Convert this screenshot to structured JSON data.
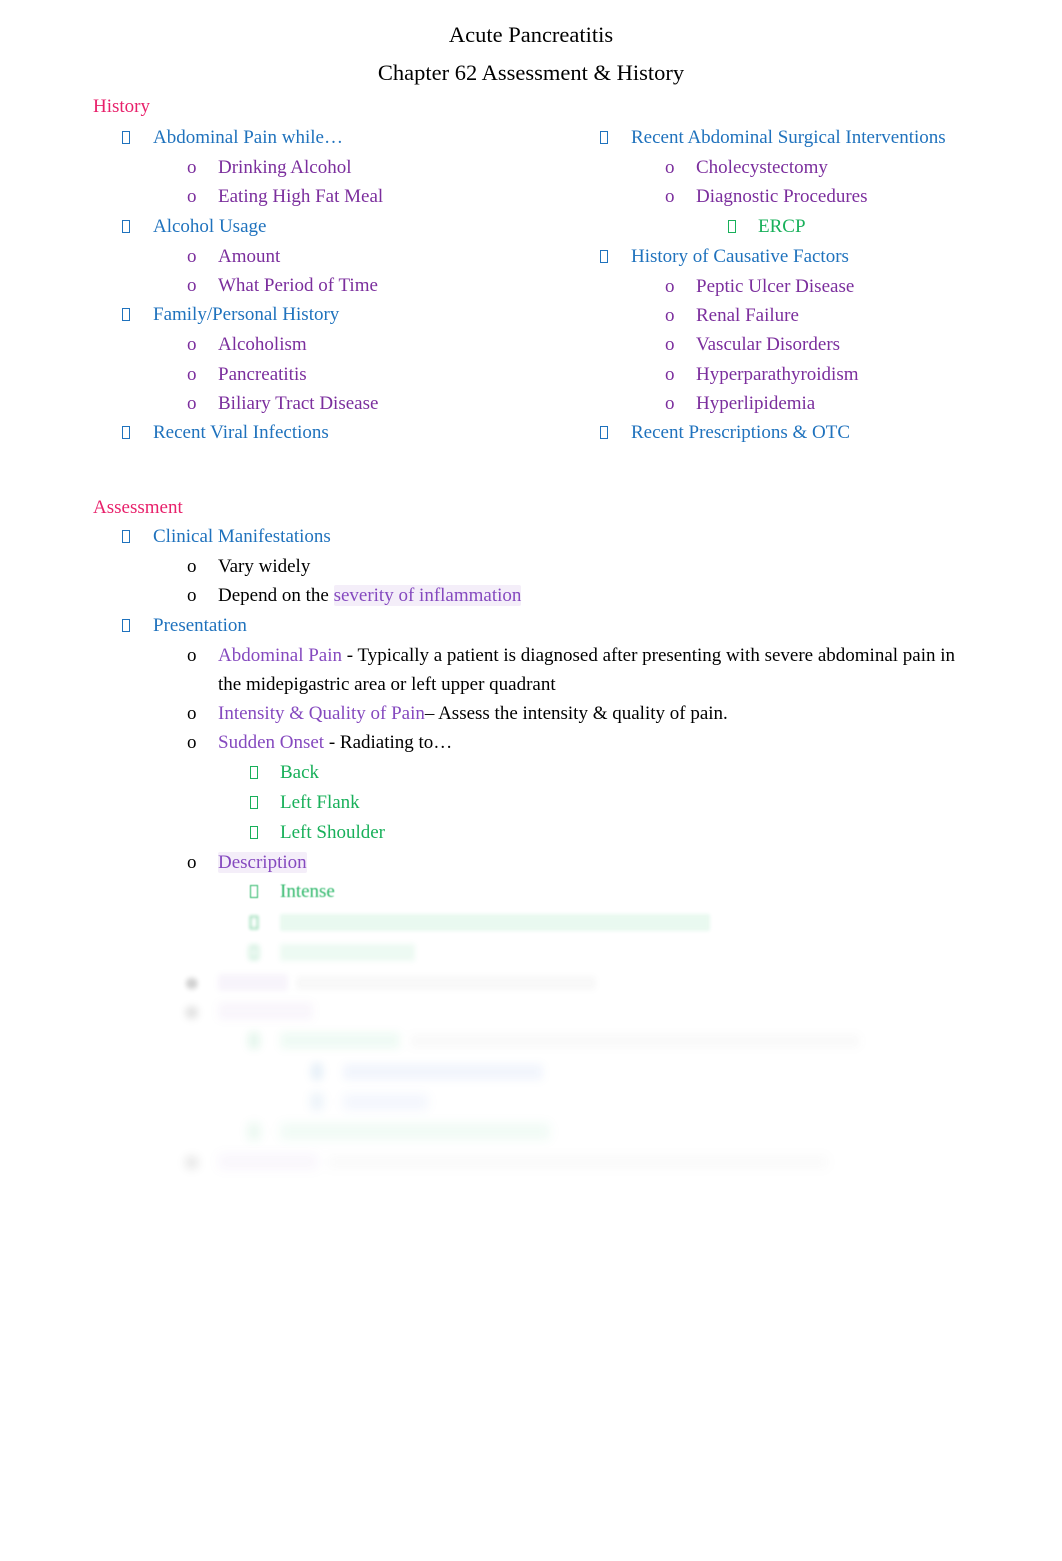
{
  "document": {
    "title": "Acute Pancreatitis",
    "subtitle": "Chapter 62 Assessment & History"
  },
  "colors": {
    "heading_pink": "#E8216B",
    "level1_blue": "#1F72BD",
    "level2_purple": "#7B2E9D",
    "level3_green": "#18B05A",
    "body_black": "#000000"
  },
  "sections": [
    {
      "heading": "History",
      "columns": {
        "left": [
          {
            "level": 1,
            "text": "Abdominal Pain while…"
          },
          {
            "level": 2,
            "text": "Drinking Alcohol"
          },
          {
            "level": 2,
            "text": "Eating High Fat Meal"
          },
          {
            "level": 1,
            "text": "Alcohol Usage"
          },
          {
            "level": 2,
            "text": "Amount"
          },
          {
            "level": 2,
            "text": "What Period of Time"
          },
          {
            "level": 1,
            "text": "Family/Personal History"
          },
          {
            "level": 2,
            "text": "Alcoholism"
          },
          {
            "level": 2,
            "text": "Pancreatitis"
          },
          {
            "level": 2,
            "text": "Biliary Tract Disease"
          },
          {
            "level": 1,
            "text": "Recent Viral Infections"
          }
        ],
        "right": [
          {
            "level": 1,
            "text": "Recent Abdominal Surgical Interventions"
          },
          {
            "level": 2,
            "text": "Cholecystectomy"
          },
          {
            "level": 2,
            "text": "Diagnostic Procedures"
          },
          {
            "level": 3,
            "text": "ERCP"
          },
          {
            "level": 1,
            "text": "History of Causative Factors"
          },
          {
            "level": 2,
            "text": "Peptic Ulcer Disease"
          },
          {
            "level": 2,
            "text": "Renal Failure"
          },
          {
            "level": 2,
            "text": "Vascular Disorders"
          },
          {
            "level": 2,
            "text": "Hyperparathyroidism"
          },
          {
            "level": 2,
            "text": "Hyperlipidemia"
          },
          {
            "level": 1,
            "text": "Recent Prescriptions & OTC"
          }
        ]
      }
    },
    {
      "heading": "Assessment",
      "items": [
        {
          "level": 1,
          "text": "Clinical Manifestations"
        },
        {
          "level": 2,
          "text": "Vary widely"
        },
        {
          "level": 2,
          "lead": "Depend on the ",
          "emphasis": "severity of inflammation"
        },
        {
          "level": 1,
          "text": "Presentation"
        },
        {
          "level": 2,
          "term": "Abdominal Pain",
          "body": " - Typically a patient is diagnosed after presenting with severe abdominal pain in the midepigastric area or left upper quadrant"
        },
        {
          "level": 2,
          "term": "Intensity & Quality of Pain",
          "body": "– Assess the intensity & quality of pain."
        },
        {
          "level": 2,
          "term": "Sudden Onset",
          "body": " - Radiating to…"
        },
        {
          "level": 3,
          "text": "Back"
        },
        {
          "level": 3,
          "text": "Left Flank"
        },
        {
          "level": 3,
          "text": "Left Shoulder"
        },
        {
          "level": 2,
          "term": "Description"
        },
        {
          "level": 3,
          "text": "Intense"
        }
      ]
    }
  ],
  "obscured": {
    "note": "Lower portion of the page is progressively blurred in the scan and is not legible.",
    "lines": [
      {
        "level": 3,
        "color": "green",
        "approx_width": 430
      },
      {
        "level": 3,
        "color": "green",
        "approx_width": 135
      },
      {
        "level": 2,
        "color": "purple",
        "term_width": 70,
        "body_width": 300
      },
      {
        "level": 2,
        "color": "purple",
        "term_width": 95
      },
      {
        "level": 3,
        "color": "green",
        "term_width": 120,
        "body_width": 450
      },
      {
        "level": 4,
        "color": "blue",
        "approx_width": 200
      },
      {
        "level": 4,
        "color": "blue",
        "approx_width": 85
      },
      {
        "level": 3,
        "color": "green",
        "approx_width": 270
      },
      {
        "level": 2,
        "color": "purple",
        "term_width": 100,
        "body_width": 500
      }
    ]
  }
}
